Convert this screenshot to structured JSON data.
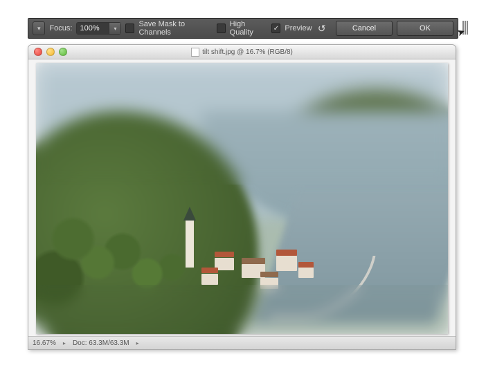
{
  "options_bar": {
    "focus_label": "Focus:",
    "focus_value": "100%",
    "save_mask_label": "Save Mask to Channels",
    "save_mask_checked": false,
    "high_quality_label": "High Quality",
    "high_quality_checked": false,
    "preview_label": "Preview",
    "preview_checked": true,
    "cancel_label": "Cancel",
    "ok_label": "OK"
  },
  "document": {
    "title": "tilt shift.jpg @ 16.7% (RGB/8)"
  },
  "status_bar": {
    "zoom": "16.67%",
    "doc_info": "Doc: 63.3M/63.3M"
  }
}
